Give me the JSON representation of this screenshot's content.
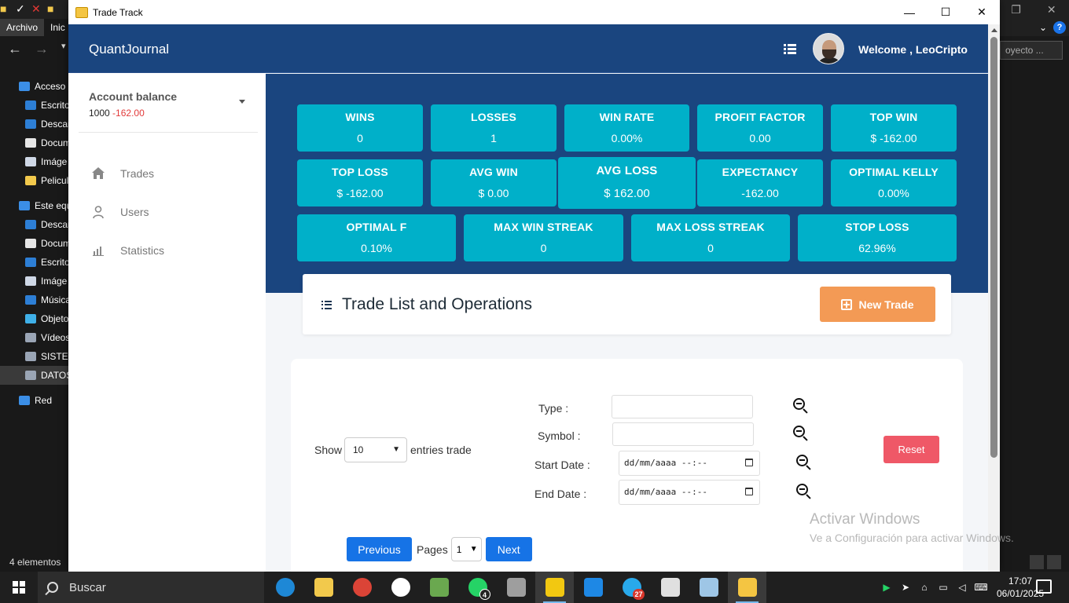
{
  "bg_explorer": {
    "menu": [
      "Archivo",
      "Inic"
    ],
    "tree": [
      {
        "label": "Acceso",
        "color": "#3b8ee6"
      },
      {
        "label": "Escrito",
        "color": "#2d7fd6"
      },
      {
        "label": "Descar",
        "color": "#2d7fd6"
      },
      {
        "label": "Docum",
        "color": "#e6e6e6"
      },
      {
        "label": "Imáge",
        "color": "#cfd8e6"
      },
      {
        "label": "Pelicul",
        "color": "#f2c94c"
      },
      {
        "label": "Este equ",
        "color": "#3b8ee6"
      },
      {
        "label": "Descar",
        "color": "#2d7fd6"
      },
      {
        "label": "Docum",
        "color": "#e6e6e6"
      },
      {
        "label": "Escrito",
        "color": "#2d7fd6"
      },
      {
        "label": "Imáge",
        "color": "#cfd8e6"
      },
      {
        "label": "Música",
        "color": "#2d7fd6"
      },
      {
        "label": "Objeto",
        "color": "#3fb0e8"
      },
      {
        "label": "Vídeos",
        "color": "#9aa5b5"
      },
      {
        "label": "SISTEM",
        "color": "#9aa5b5"
      },
      {
        "label": "DATOS",
        "color": "#9aa5b5"
      },
      {
        "label": "Red",
        "color": "#3b8ee6"
      }
    ],
    "status": "4 elementos",
    "search_placeholder": "oyecto ..."
  },
  "window": {
    "title": "Trade Track"
  },
  "sidebar": {
    "brand": "QuantJournal",
    "account_title": "Account balance",
    "account_balance": "1000",
    "account_pnl": "-162.00",
    "nav": [
      {
        "label": "Trades",
        "icon": "home-icon"
      },
      {
        "label": "Users",
        "icon": "user-icon"
      },
      {
        "label": "Statistics",
        "icon": "bar-chart-icon"
      }
    ]
  },
  "header": {
    "welcome": "Welcome , LeoCripto"
  },
  "stats_row1": [
    {
      "label": "WINS",
      "value": "0"
    },
    {
      "label": "LOSSES",
      "value": "1"
    },
    {
      "label": "WIN RATE",
      "value": "0.00%"
    },
    {
      "label": "PROFIT FACTOR",
      "value": "0.00"
    },
    {
      "label": "TOP WIN",
      "value": "$ -162.00"
    }
  ],
  "stats_row2": [
    {
      "label": "TOP LOSS",
      "value": "$ -162.00"
    },
    {
      "label": "AVG WIN",
      "value": "$ 0.00"
    },
    {
      "label": "AVG LOSS",
      "value": "$ 162.00"
    },
    {
      "label": "EXPECTANCY",
      "value": "-162.00"
    },
    {
      "label": "OPTIMAL KELLY",
      "value": "0.00%"
    }
  ],
  "stats_row3": [
    {
      "label": "OPTIMAL F",
      "value": "0.10%"
    },
    {
      "label": "MAX WIN STREAK",
      "value": "0"
    },
    {
      "label": "MAX LOSS STREAK",
      "value": "0"
    },
    {
      "label": "STOP LOSS",
      "value": "62.96%"
    }
  ],
  "trade_list": {
    "title": "Trade List and Operations",
    "new_trade": "New Trade"
  },
  "filters": {
    "show_label": "Show",
    "show_value": "10",
    "entries_label": "entries trade",
    "type_label": "Type :",
    "symbol_label": "Symbol :",
    "start_label": "Start Date :",
    "end_label": "End Date :",
    "date_placeholder": "dd/mm/aaaa --:--",
    "reset": "Reset"
  },
  "pager": {
    "previous": "Previous",
    "pages_label": "Pages",
    "page_value": "1",
    "next": "Next"
  },
  "watermark": {
    "line1": "Activar Windows",
    "line2": "Ve a Configuración para activar Windows."
  },
  "taskbar": {
    "search": "Buscar",
    "apps": [
      {
        "name": "edge",
        "color": "#1e88d6",
        "badge": ""
      },
      {
        "name": "file-explorer",
        "color": "#f2c94c",
        "badge": ""
      },
      {
        "name": "chrome",
        "color": "#db4437",
        "badge": ""
      },
      {
        "name": "app-key",
        "color": "#ffffff",
        "badge": ""
      },
      {
        "name": "chess",
        "color": "#6aa84f",
        "badge": ""
      },
      {
        "name": "whatsapp",
        "color": "#25d366",
        "badge": "4"
      },
      {
        "name": "settings",
        "color": "#9e9e9e",
        "badge": ""
      },
      {
        "name": "power-bi",
        "color": "#f2c811",
        "badge": ""
      },
      {
        "name": "vscode",
        "color": "#1e88e5",
        "badge": ""
      },
      {
        "name": "telegram",
        "color": "#29a9eb",
        "badge": "27"
      },
      {
        "name": "mail",
        "color": "#e0e0e0",
        "badge": ""
      },
      {
        "name": "notes",
        "color": "#9ec6e6",
        "badge": ""
      },
      {
        "name": "trade-track",
        "color": "#f4c542",
        "badge": ""
      }
    ],
    "time": "17:07",
    "date": "06/01/2025"
  },
  "colors": {
    "primary_dark": "#1a457f",
    "stat_card": "#00b0c9",
    "new_trade": "#f39a55",
    "reset": "#ef5867",
    "pager_button": "#1673e6",
    "negative": "#e23b3b"
  }
}
